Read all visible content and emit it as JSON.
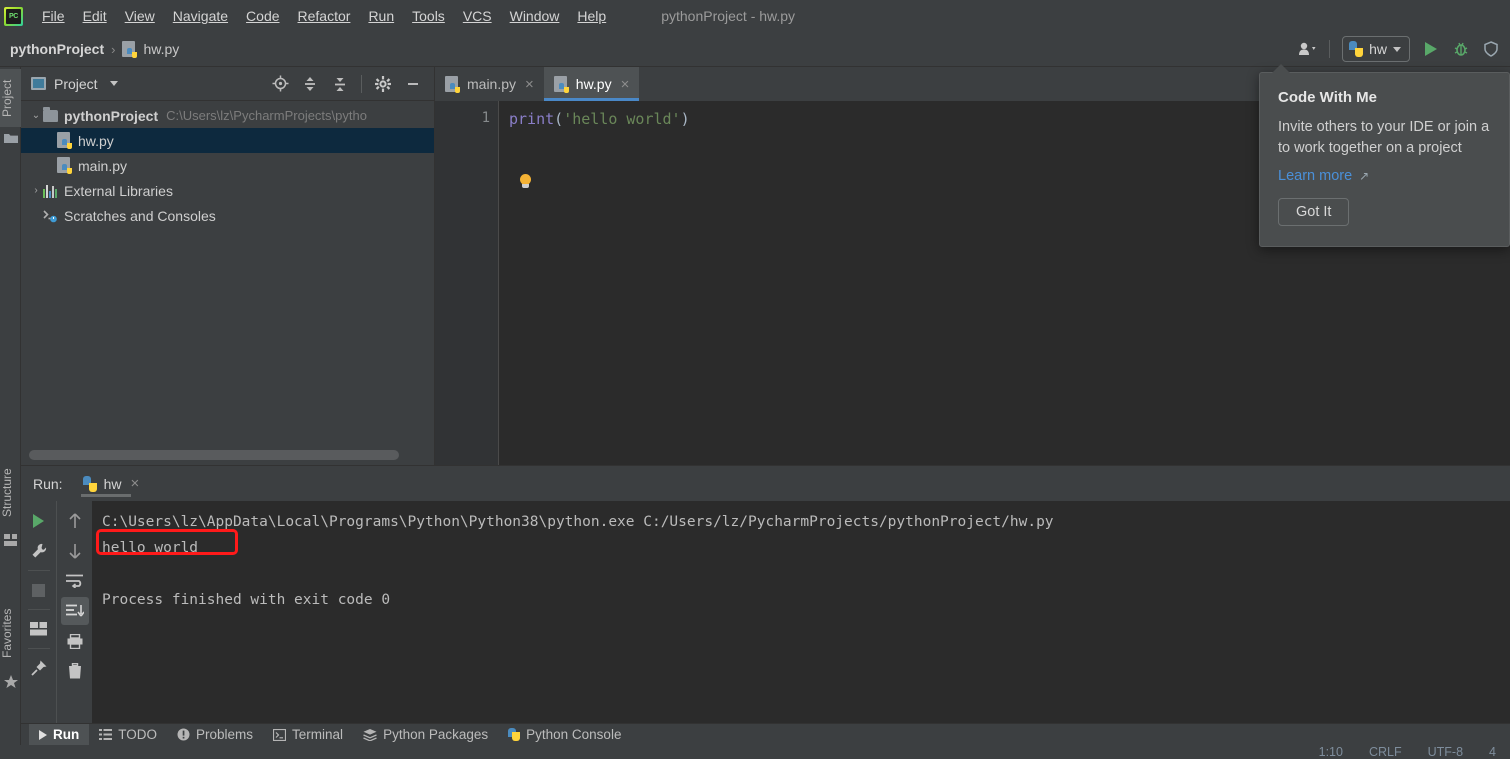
{
  "window": {
    "title": "pythonProject - hw.py",
    "app_icon": "pycharm-logo-icon"
  },
  "menubar": {
    "items": [
      {
        "label": "File"
      },
      {
        "label": "Edit"
      },
      {
        "label": "View"
      },
      {
        "label": "Navigate"
      },
      {
        "label": "Code"
      },
      {
        "label": "Refactor"
      },
      {
        "label": "Run"
      },
      {
        "label": "Tools"
      },
      {
        "label": "VCS"
      },
      {
        "label": "Window"
      },
      {
        "label": "Help"
      }
    ]
  },
  "navbar": {
    "breadcrumbs": [
      {
        "label": "pythonProject"
      },
      {
        "label": "hw.py"
      }
    ],
    "separator": "›",
    "account_icon": "user-account-icon",
    "run_config": {
      "name": "hw",
      "icon": "python-icon"
    },
    "run_button_icon": "run-play-icon",
    "debug_button_icon": "debug-bug-icon",
    "coverage_button_icon": "coverage-shield-icon"
  },
  "left_stripe": {
    "project_label": "Project",
    "structure_label": "Structure",
    "favorites_label": "Favorites"
  },
  "project_panel": {
    "title": "Project",
    "dropdown_icon": "chevron-down-icon",
    "tools": [
      {
        "name": "locate-target-icon"
      },
      {
        "name": "expand-all-icon"
      },
      {
        "name": "collapse-all-icon"
      },
      {
        "name": "settings-gear-icon"
      },
      {
        "name": "minimize-icon"
      }
    ],
    "tree": [
      {
        "label": "pythonProject",
        "path": "C:\\Users\\lz\\PycharmProjects\\pytho",
        "icon": "folder-icon",
        "arrow": "⌄",
        "depth": 0,
        "bold": true,
        "selected": false
      },
      {
        "label": "hw.py",
        "path": "",
        "icon": "python-file-icon",
        "arrow": "",
        "depth": 1,
        "bold": false,
        "selected": true
      },
      {
        "label": "main.py",
        "path": "",
        "icon": "python-file-icon",
        "arrow": "",
        "depth": 1,
        "bold": false,
        "selected": false
      },
      {
        "label": "External Libraries",
        "path": "",
        "icon": "libraries-icon",
        "arrow": "›",
        "depth": 0,
        "bold": false,
        "selected": false
      },
      {
        "label": "Scratches and Consoles",
        "path": "",
        "icon": "scratches-icon",
        "arrow": "",
        "depth": 0,
        "bold": false,
        "selected": false
      }
    ]
  },
  "editor": {
    "tabs": [
      {
        "label": "main.py",
        "active": false,
        "icon": "python-file-icon",
        "close": "×"
      },
      {
        "label": "hw.py",
        "active": true,
        "icon": "python-file-icon",
        "close": "×"
      }
    ],
    "line_number": "1",
    "code": {
      "fn": "print",
      "open_paren": "(",
      "string": "'hello world'",
      "close_paren": ")"
    },
    "intention_icon": "lightbulb-icon"
  },
  "run_panel": {
    "label": "Run:",
    "tab": {
      "label": "hw",
      "icon": "python-icon",
      "close": "×"
    },
    "tools_left": [
      {
        "name": "rerun-play-icon"
      },
      {
        "name": "edit-configuration-wrench-icon"
      },
      {
        "name": "stop-icon"
      },
      {
        "name": "layout-icon"
      },
      {
        "name": "pin-tab-icon"
      }
    ],
    "tools_right": [
      {
        "name": "up-arrow-icon"
      },
      {
        "name": "down-arrow-icon"
      },
      {
        "name": "soft-wrap-icon"
      },
      {
        "name": "scroll-to-end-icon"
      },
      {
        "name": "print-icon"
      },
      {
        "name": "clear-all-trash-icon"
      }
    ],
    "console_lines": [
      "C:\\Users\\lz\\AppData\\Local\\Programs\\Python\\Python38\\python.exe C:/Users/lz/PycharmProjects/pythonProject/hw.py",
      "hello world",
      "",
      "Process finished with exit code 0"
    ]
  },
  "annotation": {
    "highlight_color": "#ff1a1a",
    "highlighted_text": "hello world"
  },
  "bottom_bar": {
    "items": [
      {
        "label": "Run",
        "icon": "run-play-icon",
        "active": true
      },
      {
        "label": "TODO",
        "icon": "todo-list-icon",
        "active": false
      },
      {
        "label": "Problems",
        "icon": "problems-warning-icon",
        "active": false
      },
      {
        "label": "Terminal",
        "icon": "terminal-icon",
        "active": false
      },
      {
        "label": "Python Packages",
        "icon": "packages-icon",
        "active": false
      },
      {
        "label": "Python Console",
        "icon": "python-icon",
        "active": false
      }
    ]
  },
  "status_bar": {
    "caret_position": "1:10",
    "line_separator": "CRLF",
    "encoding": "UTF-8",
    "indent": "4"
  },
  "popup": {
    "title": "Code With Me",
    "body": "Invite others to your IDE or join a",
    "body2": "to work together on a project",
    "link_label": "Learn more",
    "link_icon": "external-link-icon",
    "button_label": "Got It"
  },
  "colors": {
    "panel_bg": "#3c3f41",
    "editor_bg": "#2b2b2b",
    "selection_bg": "#0d293e",
    "tab_underline": "#4a88c7",
    "accent_green": "#59a869",
    "link_blue": "#4a90d9"
  }
}
